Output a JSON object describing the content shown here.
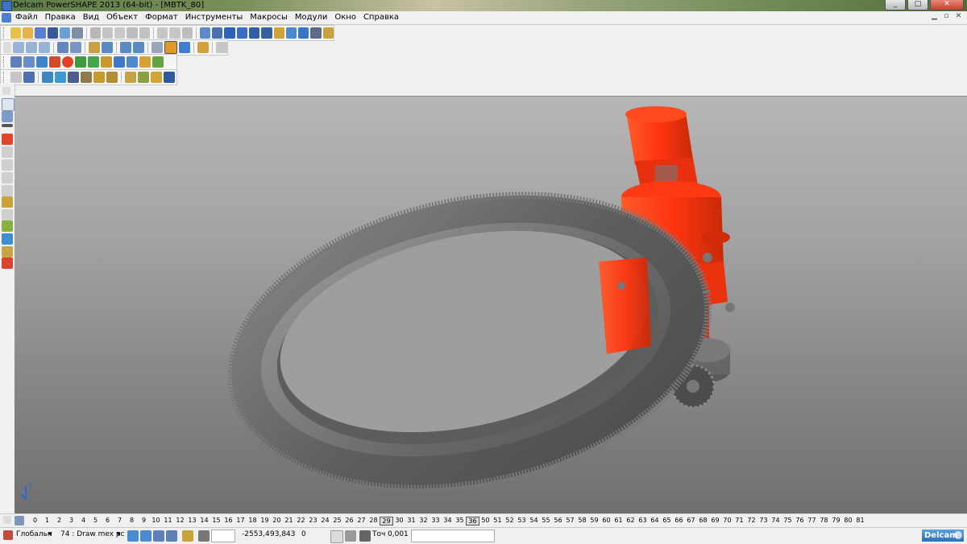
{
  "window": {
    "title": "Delcam PowerSHAPE 2013 (64-bit) - [MBTK_80]",
    "controls": [
      "_",
      "□",
      "✕"
    ]
  },
  "menu": {
    "items": [
      "Файл",
      "Правка",
      "Вид",
      "Объект",
      "Формат",
      "Инструменты",
      "Макросы",
      "Модули",
      "Окно",
      "Справка"
    ]
  },
  "levels": {
    "numbers": [
      "0",
      "1",
      "2",
      "3",
      "4",
      "5",
      "6",
      "7",
      "8",
      "9",
      "10",
      "11",
      "12",
      "13",
      "14",
      "15",
      "16",
      "17",
      "18",
      "19",
      "20",
      "21",
      "22",
      "23",
      "24",
      "25",
      "26",
      "27",
      "28",
      "29",
      "30",
      "31",
      "32",
      "33",
      "34",
      "35",
      "36",
      "50",
      "51",
      "52",
      "53",
      "54",
      "55",
      "56",
      "57",
      "58",
      "59",
      "60",
      "61",
      "62",
      "63",
      "64",
      "65",
      "66",
      "67",
      "68",
      "69",
      "70",
      "71",
      "72",
      "73",
      "74",
      "75",
      "76",
      "77",
      "78",
      "79",
      "80",
      "81"
    ],
    "boxed": [
      "29",
      "36"
    ]
  },
  "status": {
    "workplane": "Глобальн",
    "level_select": "74 : Draw mex рс",
    "x": "-2553,4",
    "y": "93,843",
    "z": "0",
    "tol_label": "Точ",
    "tol_value": "0,001"
  },
  "logo": {
    "text": "Delcam"
  },
  "axis_label": "Y",
  "colors": {
    "gear": "#6f6f6f",
    "drive": "#ff3a10",
    "viewport_top": "#b6b6b6",
    "viewport_bottom": "#6f6f6f"
  }
}
